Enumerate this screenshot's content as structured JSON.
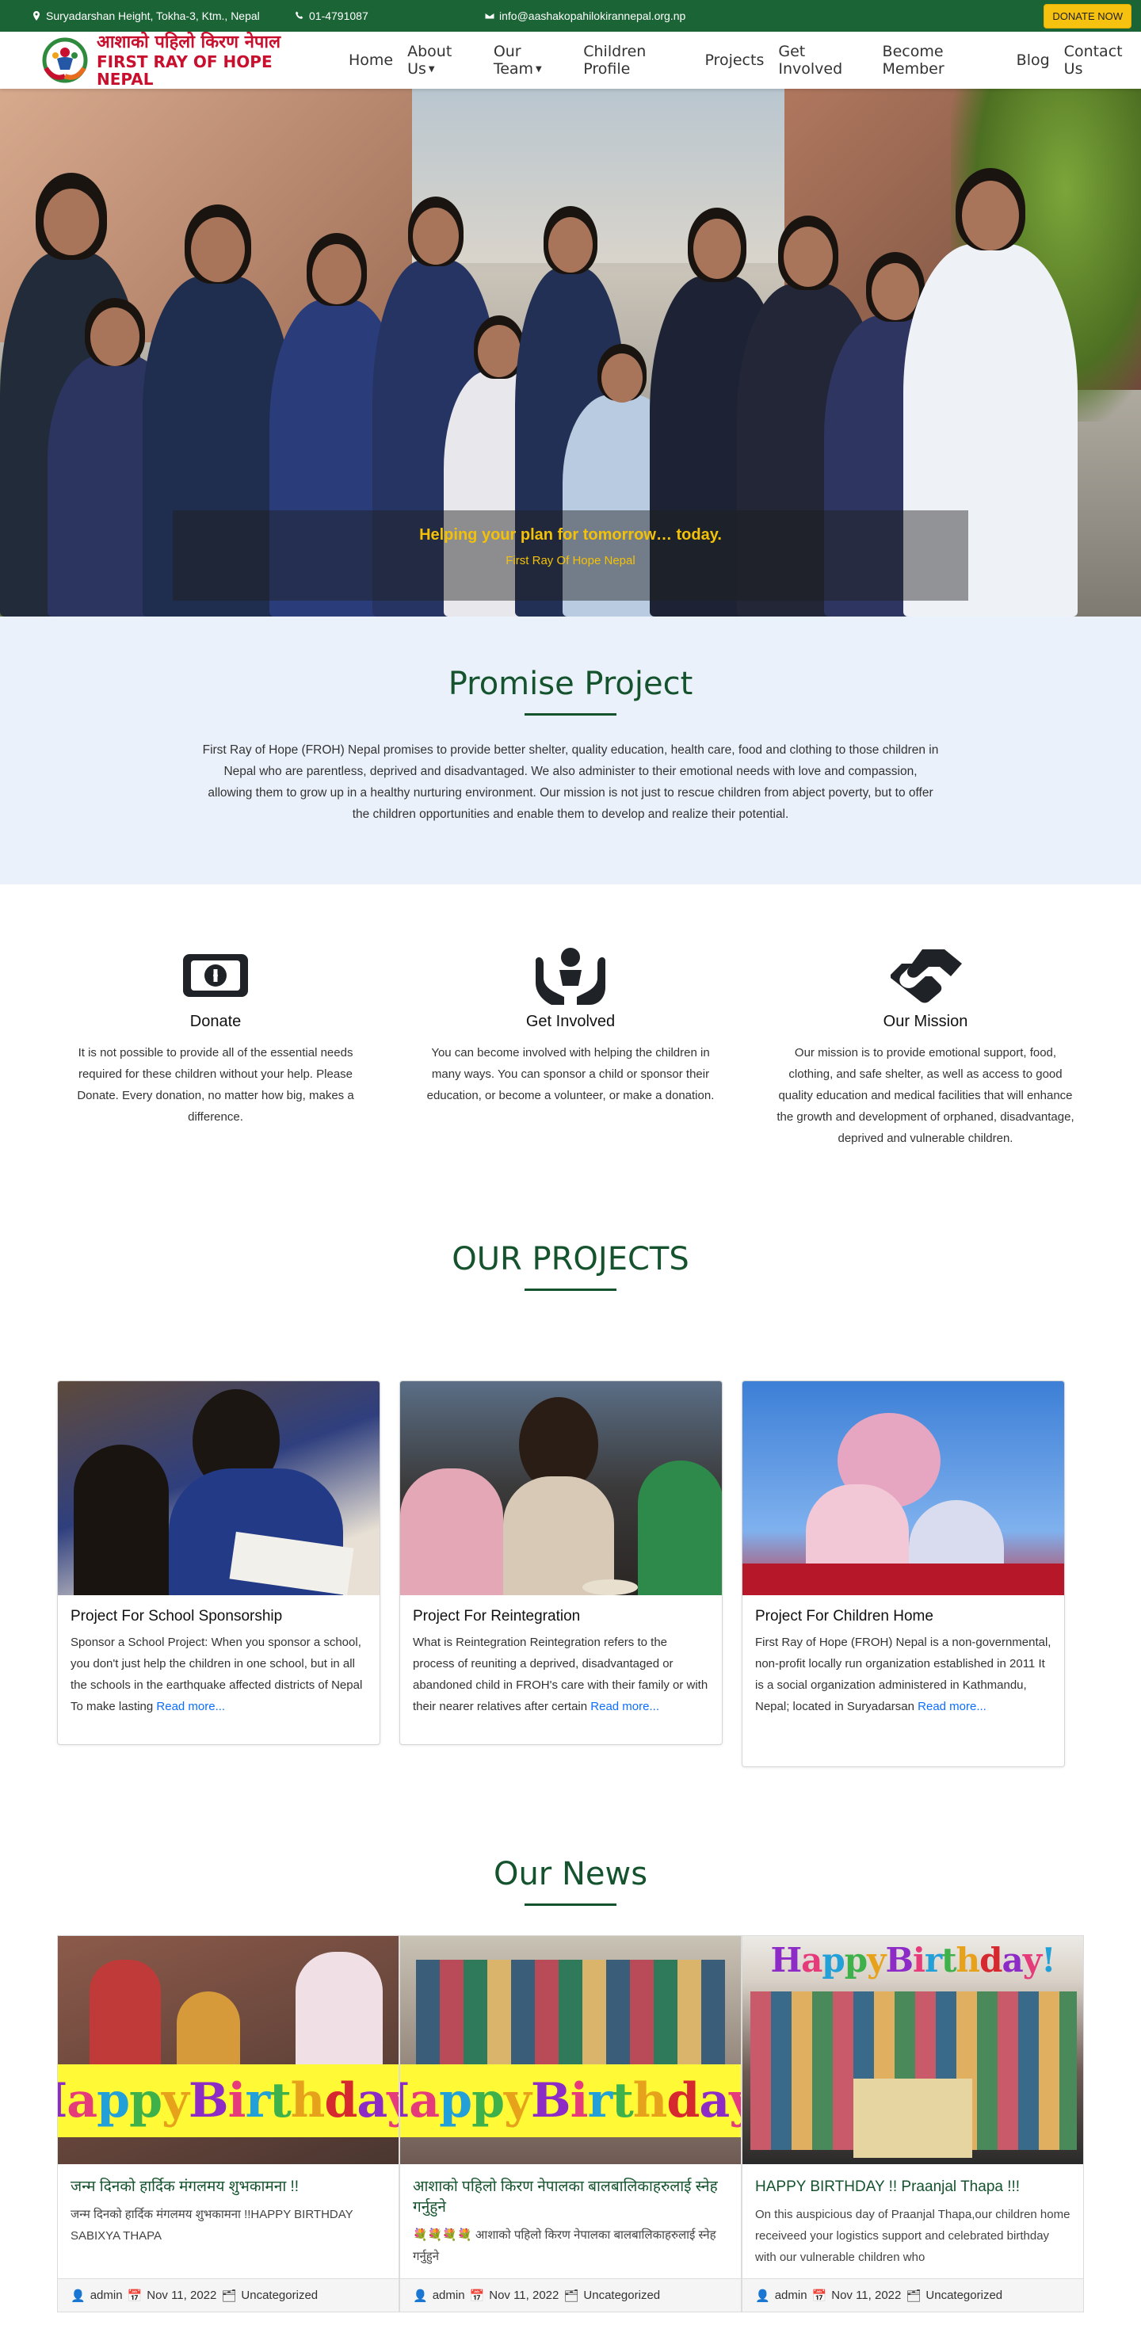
{
  "topbar": {
    "address": "Suryadarshan Height, Tokha-3, Ktm., Nepal",
    "phone": "01-4791087",
    "email": "info@aashakopahilokirannepal.org.np",
    "donate_label": "DONATE NOW"
  },
  "brand": {
    "name_np": "आशाको पहिलो किरण नेपाल",
    "name_en": "FIRST RAY OF HOPE NEPAL"
  },
  "nav": {
    "items": [
      "Home",
      "About Us",
      "Our Team",
      "Children Profile",
      "Projects",
      "Get Involved",
      "Become Member",
      "Blog",
      "Contact Us"
    ]
  },
  "hero": {
    "caption_title": "Helping your plan for tomorrow… today.",
    "caption_sub": "First Ray Of Hope Nepal"
  },
  "promise": {
    "title": "Promise Project",
    "text": "First Ray of Hope (FROH) Nepal promises to provide better shelter, quality education, health care, food and clothing to those children in Nepal who are parentless, deprived and disadvantaged. We also administer to their emotional needs with love and compassion, allowing them to grow up in a healthy nurturing environment. Our mission is not just to rescue children from abject poverty, but to offer the children opportunities and enable them to develop and realize their potential."
  },
  "features": [
    {
      "icon": "money-bill-icon",
      "title": "Donate",
      "text": "It is not possible to provide all of the essential needs required for these children without your help. Please Donate. Every donation, no matter how big, makes a difference."
    },
    {
      "icon": "hands-holding-child-icon",
      "title": "Get Involved",
      "text": "You can become involved with helping the children in many ways. You can sponsor a child or sponsor their education, or become a volunteer, or make a donation."
    },
    {
      "icon": "handshake-icon",
      "title": "Our Mission",
      "text": "Our mission is to provide emotional support, food, clothing, and safe shelter, as well as access to good quality education and medical facilities that will enhance the growth and development of orphaned, disadvantage, deprived and vulnerable children."
    }
  ],
  "projects": {
    "title": "OUR PROJECTS",
    "read_more": "Read more...",
    "items": [
      {
        "title": "Project For School Sponsorship",
        "text": "Sponsor a School Project: When you sponsor a school, you don't just help the children in one school, but in all the schools in the earthquake affected districts of Nepal To make lasting"
      },
      {
        "title": "Project For Reintegration",
        "text": "What is Reintegration Reintegration refers to the process of reuniting a deprived, disadvantaged or abandoned child in FROH's care with their family or with their nearer relatives after certain"
      },
      {
        "title": "Project For Children Home",
        "text": "First Ray of Hope (FROH) Nepal is a non-governmental, non-profit locally run organization established in 2011 It is a social organization administered in Kathmandu, Nepal; located in Suryadarsan"
      }
    ]
  },
  "news": {
    "title": "Our News",
    "banner": "Happy Birthday!",
    "items": [
      {
        "title": "जन्म दिनको हार्दिक मंगलमय शुभकामना !!",
        "text": "जन्म दिनको हार्दिक मंगलमय शुभकामना !!HAPPY BIRTHDAY SABIXYA THAPA",
        "author": "admin",
        "date": "Nov 11, 2022",
        "category": "Uncategorized"
      },
      {
        "title": "आशाकाे पहिलाे किरण नेपालका बालबालिकाहरुलाई स्नेह गर्नुहुने",
        "text": "💐💐💐💐 आशाकाे पहिलाे किरण नेपालका बालबालिकाहरुलाई स्नेह गर्नुहुने",
        "author": "admin",
        "date": "Nov 11, 2022",
        "category": "Uncategorized"
      },
      {
        "title": "HAPPY BIRTHDAY !! Praanjal Thapa !!!",
        "text": "On this auspicious day of Praanjal Thapa,our children home receiveed your logistics support and celebrated birthday with our vulnerable children who",
        "author": "admin",
        "date": "Nov 11, 2022",
        "category": "Uncategorized"
      }
    ]
  }
}
